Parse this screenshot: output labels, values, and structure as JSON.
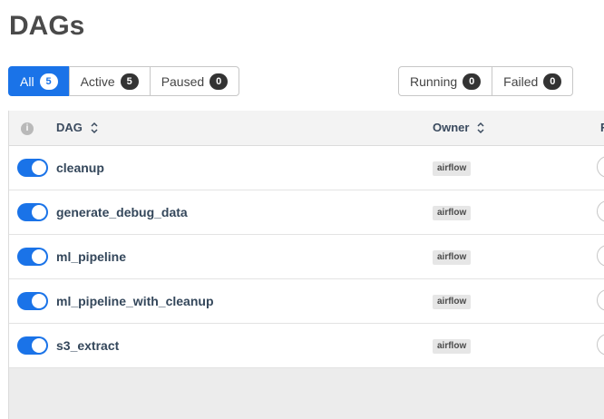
{
  "page": {
    "title": "DAGs"
  },
  "status_filters": [
    {
      "label": "All",
      "count": "5",
      "active": true
    },
    {
      "label": "Active",
      "count": "5",
      "active": false
    },
    {
      "label": "Paused",
      "count": "0",
      "active": false
    }
  ],
  "state_filters": [
    {
      "label": "Running",
      "count": "0"
    },
    {
      "label": "Failed",
      "count": "0"
    }
  ],
  "table": {
    "info_icon": "i",
    "columns": {
      "dag": "DAG",
      "owner": "Owner",
      "next": "R"
    },
    "rows": [
      {
        "dag": "cleanup",
        "owner": "airflow",
        "enabled": true
      },
      {
        "dag": "generate_debug_data",
        "owner": "airflow",
        "enabled": true
      },
      {
        "dag": "ml_pipeline",
        "owner": "airflow",
        "enabled": true
      },
      {
        "dag": "ml_pipeline_with_cleanup",
        "owner": "airflow",
        "enabled": true
      },
      {
        "dag": "s3_extract",
        "owner": "airflow",
        "enabled": true
      }
    ]
  },
  "colors": {
    "accent": "#1a73e8",
    "badge": "#333333"
  },
  "icons": {
    "sort": "sort-icon",
    "info": "info-icon"
  }
}
